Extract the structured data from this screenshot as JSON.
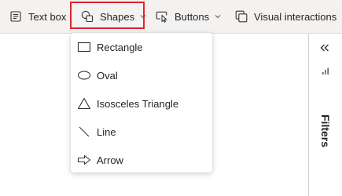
{
  "toolbar": {
    "textbox_label": "Text box",
    "shapes_label": "Shapes",
    "buttons_label": "Buttons",
    "visual_interactions_label": "Visual interactions"
  },
  "shapes_menu": {
    "items": [
      {
        "label": "Rectangle",
        "icon": "rectangle-icon"
      },
      {
        "label": "Oval",
        "icon": "oval-icon"
      },
      {
        "label": "Isosceles Triangle",
        "icon": "triangle-icon"
      },
      {
        "label": "Line",
        "icon": "line-icon"
      },
      {
        "label": "Arrow",
        "icon": "arrow-icon"
      }
    ]
  },
  "filters_pane": {
    "label": "Filters",
    "collapse_icon": "double-chevron-left-icon"
  },
  "colors": {
    "highlight": "#d9262e",
    "toolbar_bg": "#f3f2f1",
    "text": "#252423"
  }
}
